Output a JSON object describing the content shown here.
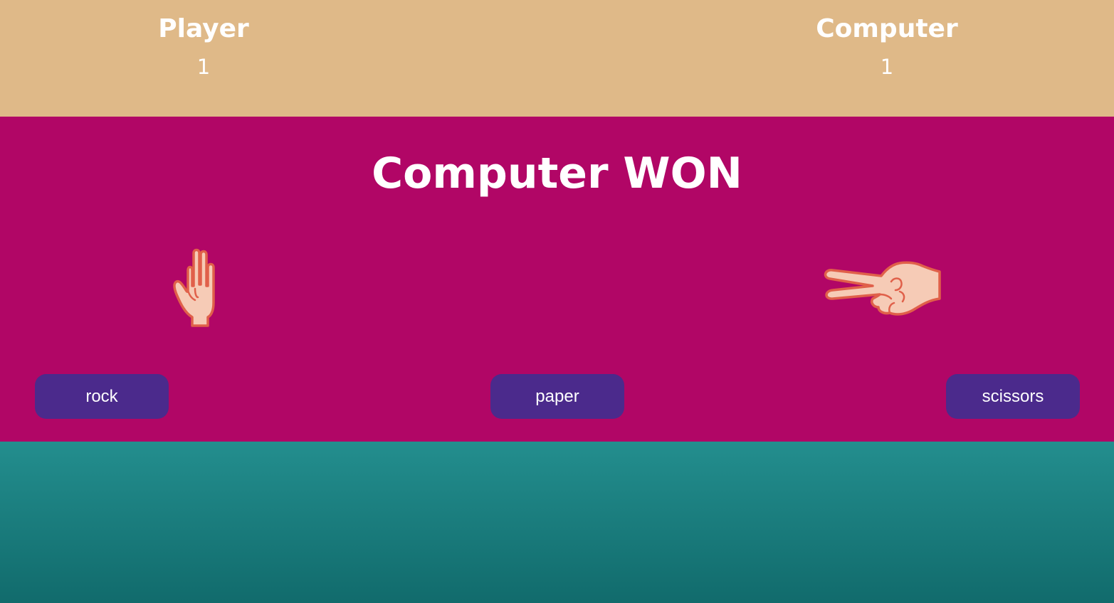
{
  "colors": {
    "scoreboard_bg": "#dfb988",
    "arena_bg": "#b10666",
    "button_bg": "#4b2a8c",
    "footer_top": "#238e8e",
    "footer_bottom": "#116b6c",
    "skin_fill": "#f6cbb6",
    "skin_outline": "#e0604a"
  },
  "scoreboard": {
    "player": {
      "label": "Player",
      "score": "1"
    },
    "computer": {
      "label": "Computer",
      "score": "1"
    }
  },
  "result": {
    "text": "Computer WON"
  },
  "hands": {
    "player": {
      "choice": "paper",
      "icon": "raised-hand-icon"
    },
    "computer": {
      "choice": "scissors",
      "icon": "victory-hand-icon"
    }
  },
  "buttons": {
    "rock": "rock",
    "paper": "paper",
    "scissors": "scissors"
  }
}
